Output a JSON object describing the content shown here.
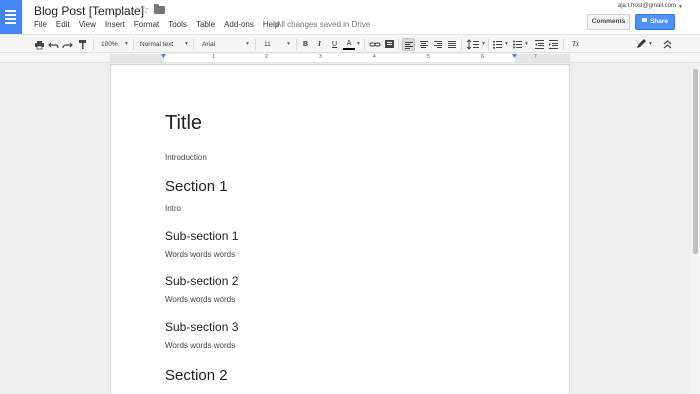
{
  "header": {
    "doc_title": "Blog Post [Template]",
    "menus": [
      "File",
      "Edit",
      "View",
      "Insert",
      "Format",
      "Tools",
      "Table",
      "Add-ons",
      "Help"
    ],
    "save_status": "All changes saved in Drive",
    "account_email": "aja.t.frost@gmail.com",
    "comments_label": "Comments",
    "share_label": "Share",
    "accent_color": "#4285f4"
  },
  "toolbar": {
    "zoom": "100%",
    "style": "Normal text",
    "font": "Arial",
    "font_size": "11",
    "bold": "B",
    "italic": "I",
    "underline": "U",
    "text_color": "A",
    "clear_format": "Tx",
    "icons": [
      "print-icon",
      "undo-icon",
      "redo-icon",
      "paint-format-icon",
      "link-icon",
      "comment-icon",
      "align-left-icon",
      "align-center-icon",
      "align-right-icon",
      "justify-icon",
      "line-spacing-icon",
      "numbered-list-icon",
      "bulleted-list-icon",
      "decrease-indent-icon",
      "increase-indent-icon",
      "clear-formatting-icon",
      "pencil-icon",
      "collapse-icon"
    ]
  },
  "ruler": {
    "numbers": [
      "1",
      "2",
      "3",
      "4",
      "5",
      "6",
      "7"
    ]
  },
  "document": {
    "title": "Title",
    "intro": "Introduction",
    "section1": "Section 1",
    "section1_body": "Intro",
    "sub1": "Sub-section 1",
    "sub1_body": "Words words words",
    "sub2": "Sub-section 2",
    "sub2_body": "Words words words",
    "sub3": "Sub-section 3",
    "sub3_body": "Words words words",
    "section2": "Section 2"
  }
}
